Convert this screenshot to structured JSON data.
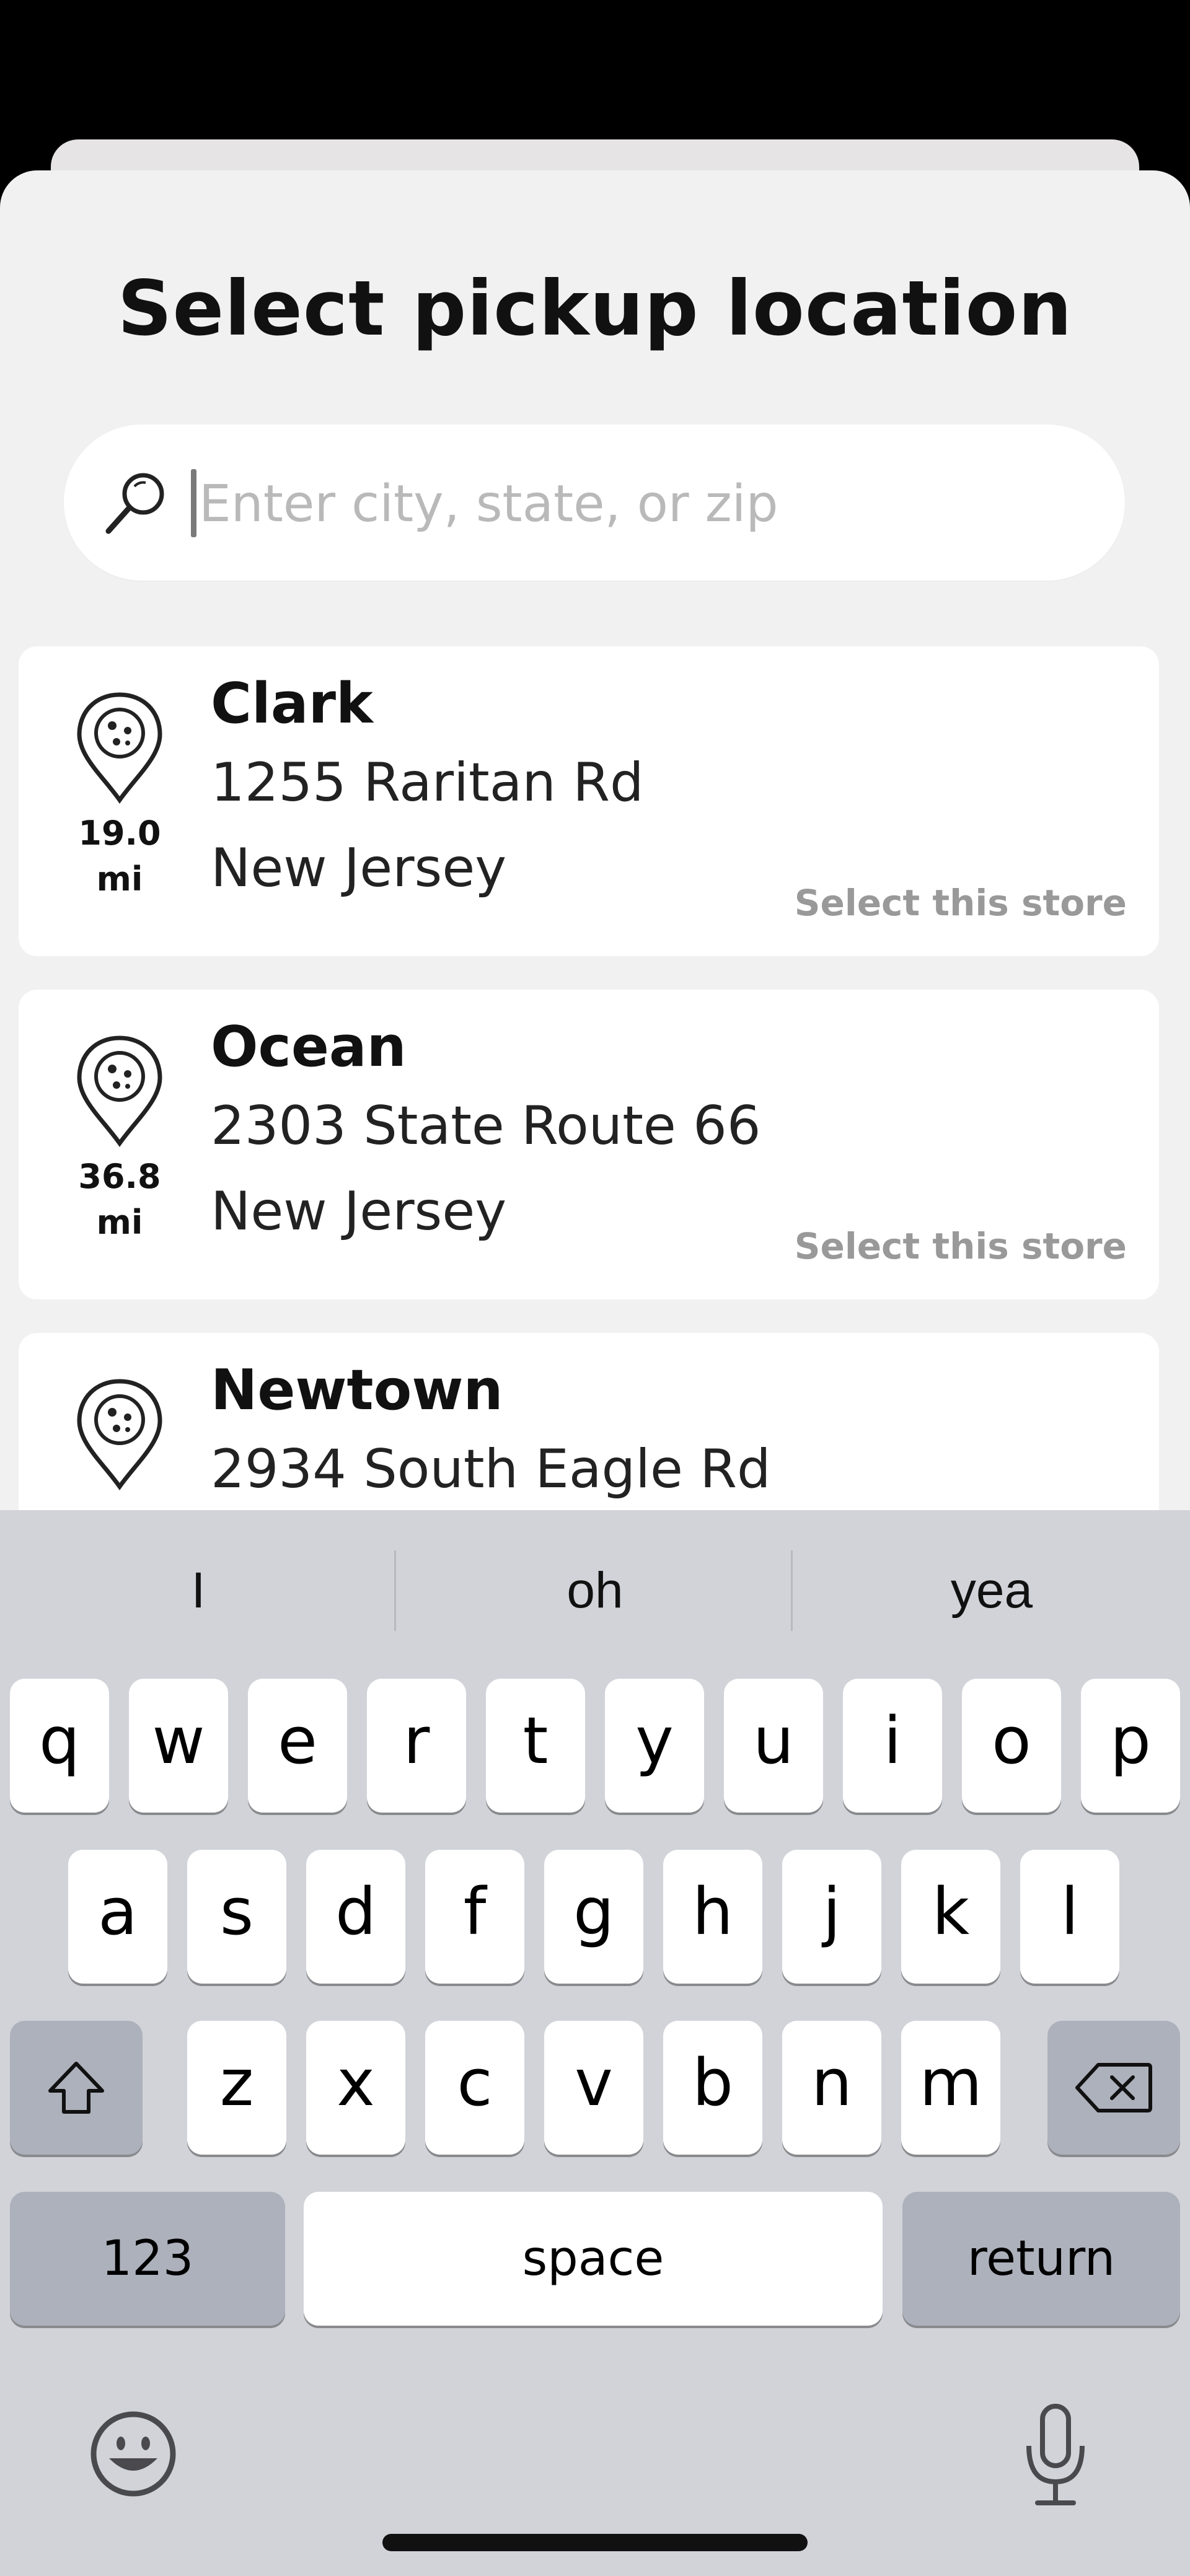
{
  "sheet": {
    "title": "Select pickup location"
  },
  "search": {
    "placeholder": "Enter city, state, or zip",
    "value": "",
    "icon": "search-icon"
  },
  "stores": [
    {
      "name": "Clark",
      "address": "1255 Raritan Rd",
      "region": "New Jersey",
      "distance_value": "19.0",
      "distance_unit": "mi",
      "action": "Select this store",
      "icon": "location-pin-icon"
    },
    {
      "name": "Ocean",
      "address": "2303 State Route 66",
      "region": "New Jersey",
      "distance_value": "36.8",
      "distance_unit": "mi",
      "action": "Select this store",
      "icon": "location-pin-icon"
    },
    {
      "name": "Newtown",
      "address": "2934 South Eagle Rd",
      "region": "",
      "distance_value": "",
      "distance_unit": "",
      "action": "",
      "icon": "location-pin-icon"
    }
  ],
  "keyboard": {
    "suggestions": [
      "I",
      "oh",
      "yea"
    ],
    "row1": [
      "q",
      "w",
      "e",
      "r",
      "t",
      "y",
      "u",
      "i",
      "o",
      "p"
    ],
    "row2": [
      "a",
      "s",
      "d",
      "f",
      "g",
      "h",
      "j",
      "k",
      "l"
    ],
    "row3": [
      "z",
      "x",
      "c",
      "v",
      "b",
      "n",
      "m"
    ],
    "numbers_label": "123",
    "space_label": "space",
    "return_label": "return",
    "shift_icon": "shift-icon",
    "delete_icon": "backspace-icon",
    "emoji_icon": "emoji-icon",
    "mic_icon": "microphone-icon"
  },
  "colors": {
    "sheet_bg": "#f1f1f1",
    "card_bg": "#ffffff",
    "muted_link": "#999999",
    "keyboard_bg": "#d1d3d9",
    "key_dark": "#adb1bb"
  }
}
